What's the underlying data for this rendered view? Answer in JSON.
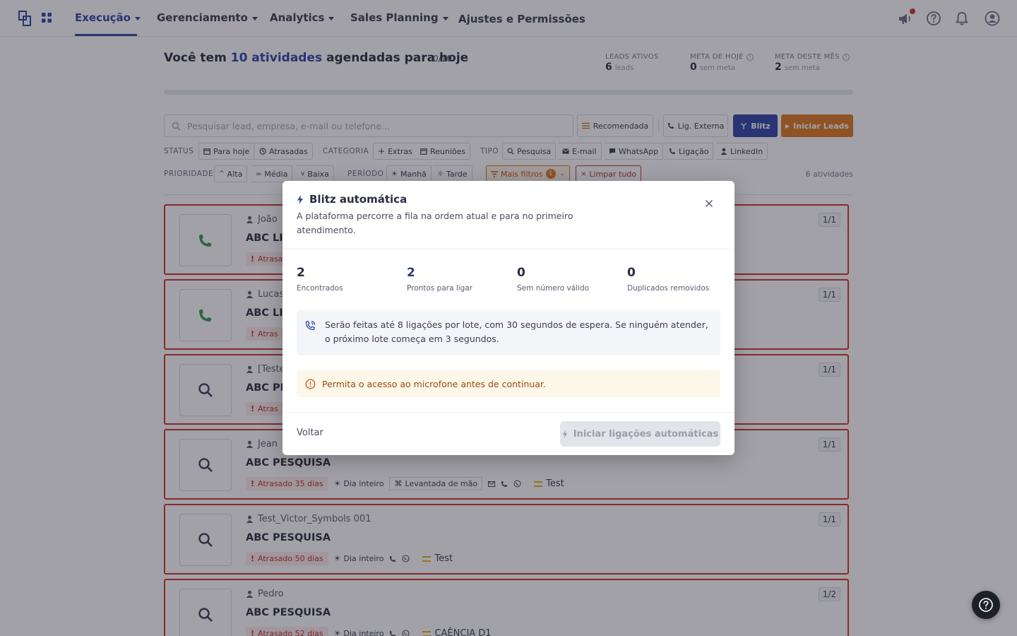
{
  "nav": {
    "items": [
      {
        "label": "Execução"
      },
      {
        "label": "Gerenciamento"
      },
      {
        "label": "Analytics"
      },
      {
        "label": "Sales Planning"
      },
      {
        "label": "Ajustes e Permissões"
      }
    ],
    "active": "Execução",
    "icons": [
      "logo-icon",
      "apps-grid-icon",
      "megaphone-icon",
      "help-circle-icon",
      "bell-icon",
      "user-avatar-icon"
    ]
  },
  "header": {
    "headline_prefix": "Você tem",
    "headline_highlight": "10 atividades",
    "headline_suffix": "agendadas para hoje",
    "progress_text": "0/10",
    "progress_fraction": 0.0,
    "kpis": [
      {
        "label": "LEADS ATIVOS",
        "value": "6",
        "sub": "leads"
      },
      {
        "label": "META DE HOJE",
        "value": "0",
        "sub": "sem meta"
      },
      {
        "label": "META DESTE MÊS",
        "value": "2",
        "sub": "sem meta"
      }
    ]
  },
  "toolbar": {
    "search_placeholder": "Pesquisar lead, empresa, e-mail ou telefone...",
    "recommended_label": "Recomendada",
    "external_call_label": "Lig. Externa",
    "blitz_label": "Blitz",
    "start_leads_label": "Iniciar Leads"
  },
  "filters": {
    "status_label": "STATUS",
    "status": [
      "Para hoje",
      "Atrasadas"
    ],
    "category_label": "CATEGORIA",
    "category": [
      "Extras",
      "Reuniões"
    ],
    "type_label": "TIPO",
    "type": [
      "Pesquisa",
      "E-mail",
      "WhatsApp",
      "Ligação",
      "LinkedIn"
    ],
    "priority_label": "PRIORIDADE",
    "priority": [
      "Alta",
      "Média",
      "Baixa"
    ],
    "period_label": "PERÍODO",
    "period": [
      "Manhã",
      "Tarde"
    ],
    "more_filters_label": "Mais filtros",
    "more_filters_count": "1",
    "clear_label": "Limpar tudo",
    "activity_count": "6 atividades"
  },
  "leads": [
    {
      "person": "João",
      "title": "ABC LIG",
      "late": "Atrasa",
      "ratio": "1/1",
      "kind": "phone"
    },
    {
      "person": "Lucas",
      "title": "ABC LIG",
      "late": "Atras",
      "ratio": "1/1",
      "kind": "phone"
    },
    {
      "person": "[Teste",
      "title": "ABC PES",
      "late": "Atras",
      "ratio": "1/1",
      "kind": "search"
    },
    {
      "person": "Jean",
      "title": "ABC PESQUISA",
      "late": "Atrasado 35 dias",
      "period": "Dia inteiro",
      "tag": "Levantada de mão",
      "priority": "Test",
      "ratio": "1/1",
      "kind": "search"
    },
    {
      "person": "Test_Victor_Symbols 001",
      "title": "ABC PESQUISA",
      "late": "Atrasado 50 dias",
      "period": "Dia inteiro",
      "priority": "Test",
      "ratio": "1/1",
      "kind": "search"
    },
    {
      "person": "Pedro",
      "title": "ABC PESQUISA",
      "late": "Atrasado 52 dias",
      "period": "Dia inteiro",
      "priority": "CAÊNCIA D1",
      "ratio": "1/2",
      "kind": "search"
    }
  ],
  "modal": {
    "title": "Blitz automática",
    "subtitle": "A plataforma percorre a fila na ordem atual e para no primeiro atendimento.",
    "stats": [
      {
        "value": "2",
        "label": "Encontrados"
      },
      {
        "value": "2",
        "label": "Prontos para ligar"
      },
      {
        "value": "0",
        "label": "Sem número válido"
      },
      {
        "value": "0",
        "label": "Duplicados removidos"
      }
    ],
    "info": "Serão feitas até 8 ligações por lote, com 30 segundos de espera. Se ninguém atender, o próximo lote começa em 3 segundos.",
    "warning": "Permita o acesso ao microfone antes de continuar.",
    "back_label": "Voltar",
    "start_label": "Iniciar ligações automáticas"
  },
  "colors": {
    "primary": "#2f44a8",
    "orange": "#e0791f",
    "danger": "#d0342c",
    "phone_green": "#2e9e4a"
  }
}
